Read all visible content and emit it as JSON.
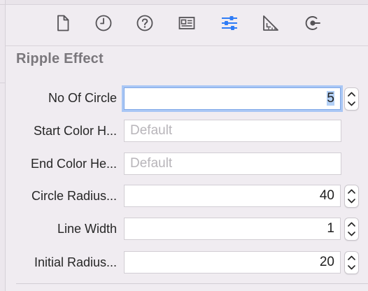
{
  "toolbar": {
    "icons": [
      {
        "name": "file-inspector-icon"
      },
      {
        "name": "history-inspector-icon"
      },
      {
        "name": "quick-help-icon"
      },
      {
        "name": "identity-inspector-icon"
      },
      {
        "name": "attributes-inspector-icon",
        "selected": true
      },
      {
        "name": "size-inspector-icon"
      },
      {
        "name": "connections-inspector-icon"
      }
    ]
  },
  "section": {
    "title": "Ripple Effect"
  },
  "fields": {
    "no_of_circle": {
      "label": "No Of Circle",
      "value": "5"
    },
    "start_color": {
      "label": "Start Color H...",
      "placeholder": "Default"
    },
    "end_color": {
      "label": "End Color He...",
      "placeholder": "Default"
    },
    "circle_radius": {
      "label": "Circle Radius...",
      "value": "40"
    },
    "line_width": {
      "label": "Line Width",
      "value": "1"
    },
    "initial_radius": {
      "label": "Initial Radius...",
      "value": "20"
    }
  },
  "colors": {
    "accent": "#2f7cf6",
    "icon": "#555357",
    "background": "#f0ecf1",
    "focus_ring": "#a9c7f5"
  }
}
